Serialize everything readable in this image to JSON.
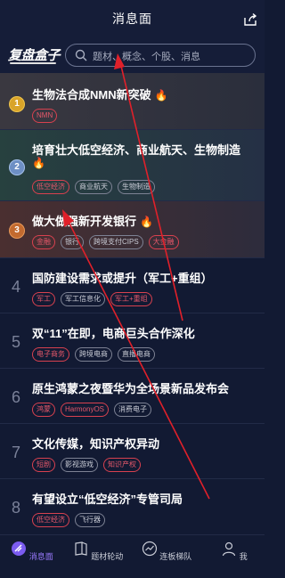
{
  "header": {
    "title": "消息面"
  },
  "logo": {
    "text": "复盘盒子"
  },
  "search": {
    "placeholder": "题材、概念、个股、消息"
  },
  "items": [
    {
      "rank": "1",
      "title": "生物法合成NMN新突破",
      "tags": [
        {
          "text": "NMN",
          "red": true
        }
      ]
    },
    {
      "rank": "2",
      "title_line1": "培育壮大低空经济、商业航天、生物制造",
      "tags": [
        {
          "text": "低空经济",
          "red": true
        },
        {
          "text": "商业航天",
          "red": false
        },
        {
          "text": "生物制造",
          "red": false
        }
      ]
    },
    {
      "rank": "3",
      "title": "做大做强新开发银行",
      "tags": [
        {
          "text": "金融",
          "red": true
        },
        {
          "text": "银行",
          "red": false
        },
        {
          "text": "跨境支付CIPS",
          "red": false
        },
        {
          "text": "大金融",
          "red": true
        }
      ]
    },
    {
      "rank": "4",
      "title": "国防建设需求或提升（军工+重组）",
      "tags": [
        {
          "text": "军工",
          "red": true
        },
        {
          "text": "军工信息化",
          "red": false
        },
        {
          "text": "军工+重组",
          "red": true
        }
      ]
    },
    {
      "rank": "5",
      "title": "双“11”在即，电商巨头合作深化",
      "tags": [
        {
          "text": "电子商务",
          "red": true
        },
        {
          "text": "跨境电商",
          "red": false
        },
        {
          "text": "直播电商",
          "red": false
        }
      ]
    },
    {
      "rank": "6",
      "title": "原生鸿蒙之夜暨华为全场景新品发布会",
      "tags": [
        {
          "text": "鸿蒙",
          "red": true
        },
        {
          "text": "HarmonyOS",
          "red": true
        },
        {
          "text": "消费电子",
          "red": false
        }
      ]
    },
    {
      "rank": "7",
      "title": "文化传媒，知识产权异动",
      "tags": [
        {
          "text": "短剧",
          "red": true
        },
        {
          "text": "影视游戏",
          "red": false
        },
        {
          "text": "知识产权",
          "red": true
        }
      ]
    },
    {
      "rank": "8",
      "title": "有望设立“低空经济”专管司局",
      "tags": [
        {
          "text": "低空经济",
          "red": true
        },
        {
          "text": "飞行器",
          "red": false
        }
      ]
    }
  ],
  "tabbar": [
    {
      "label": "消息面",
      "active": true
    },
    {
      "label": "题材轮动",
      "active": false
    },
    {
      "label": "连板梯队",
      "active": false
    },
    {
      "label": "我",
      "active": false
    }
  ]
}
